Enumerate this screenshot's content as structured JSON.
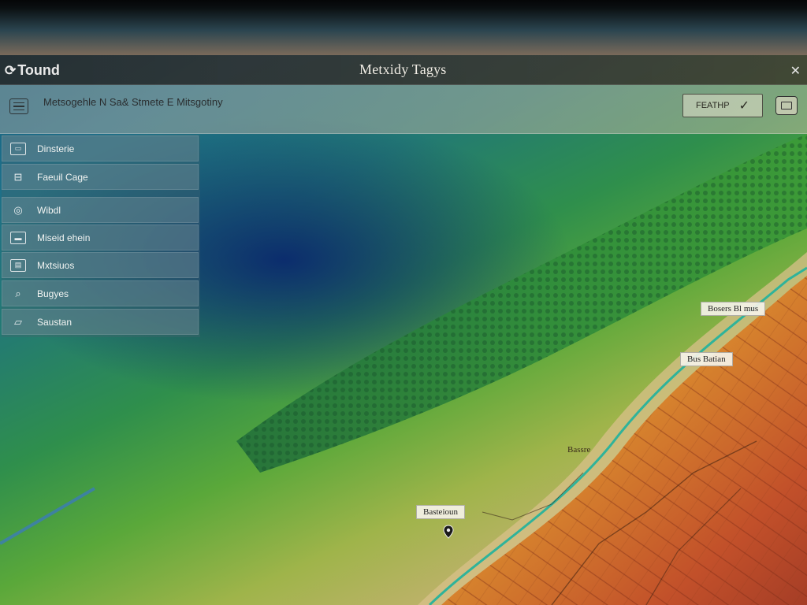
{
  "window": {
    "app_name": "Tound",
    "title": "Metxidy Tagys",
    "close_symbol": "✕"
  },
  "toolbar": {
    "breadcrumb": "Metsogehle N Sa& Stmete E Mitsgotiny",
    "filter_label": "FEATHP",
    "filter_symbol": "✓"
  },
  "sidebar": {
    "items": [
      {
        "label": "Dinsterie",
        "icon": "monitor-icon"
      },
      {
        "label": "Faeuil Cage",
        "icon": "folder-icon"
      },
      {
        "label": "Wibdl",
        "icon": "globe-icon"
      },
      {
        "label": "Miseid ehein",
        "icon": "screen-icon"
      },
      {
        "label": "Mxtsiuos",
        "icon": "document-icon"
      },
      {
        "label": "Bugyes",
        "icon": "search-icon"
      },
      {
        "label": "Saustan",
        "icon": "tray-icon"
      }
    ]
  },
  "map": {
    "labels": [
      {
        "text": "Bosers Bl mus"
      },
      {
        "text": "Bus Batian"
      },
      {
        "text": "Bassre"
      },
      {
        "text": "Basteioun"
      }
    ]
  }
}
